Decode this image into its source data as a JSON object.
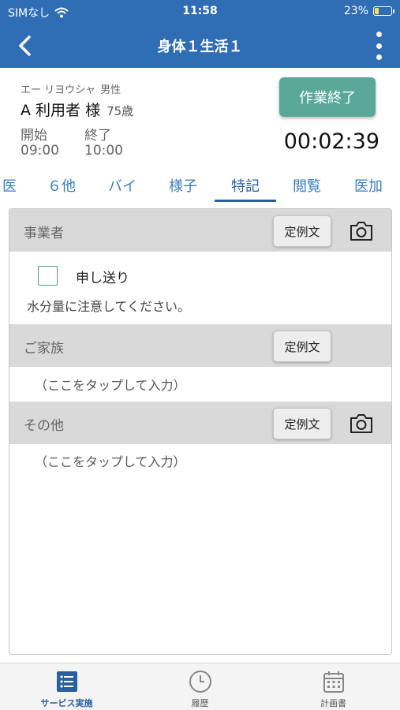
{
  "status_bar": {
    "carrier": "SIMなし",
    "time": "11:58",
    "battery": "23%",
    "battery_level": 0.23
  },
  "nav": {
    "title": "身体１生活１"
  },
  "client": {
    "kana": "エー リヨウシャ",
    "gender": "男性",
    "name": "A 利用者 様",
    "age": "75歳",
    "start_label": "開始",
    "start_time": "09:00",
    "end_label": "終了",
    "end_time": "10:00"
  },
  "finish_button": "作業終了",
  "timer": "00:02:39",
  "tabs": [
    {
      "label": "医"
    },
    {
      "label": "６他"
    },
    {
      "label": "バイ"
    },
    {
      "label": "様子"
    },
    {
      "label": "特記"
    },
    {
      "label": "閲覧"
    },
    {
      "label": "医加"
    }
  ],
  "sections": {
    "business": {
      "title": "事業者",
      "template_button": "定例文",
      "checkbox_label": "申し送り",
      "text": "水分量に注意してください。"
    },
    "family": {
      "title": "ご家族",
      "template_button": "定例文",
      "placeholder": "（ここをタップして入力）"
    },
    "other": {
      "title": "その他",
      "template_button": "定例文",
      "placeholder": "（ここをタップして入力）"
    }
  },
  "bottom_tabs": [
    {
      "label": "サービス実施",
      "icon": "list-icon"
    },
    {
      "label": "履歴",
      "icon": "clock-icon"
    },
    {
      "label": "計画書",
      "icon": "calendar-icon"
    }
  ],
  "colors": {
    "primary": "#2f6db5",
    "accent": "#5aa89a",
    "tab_active": "#2a5fa0"
  }
}
